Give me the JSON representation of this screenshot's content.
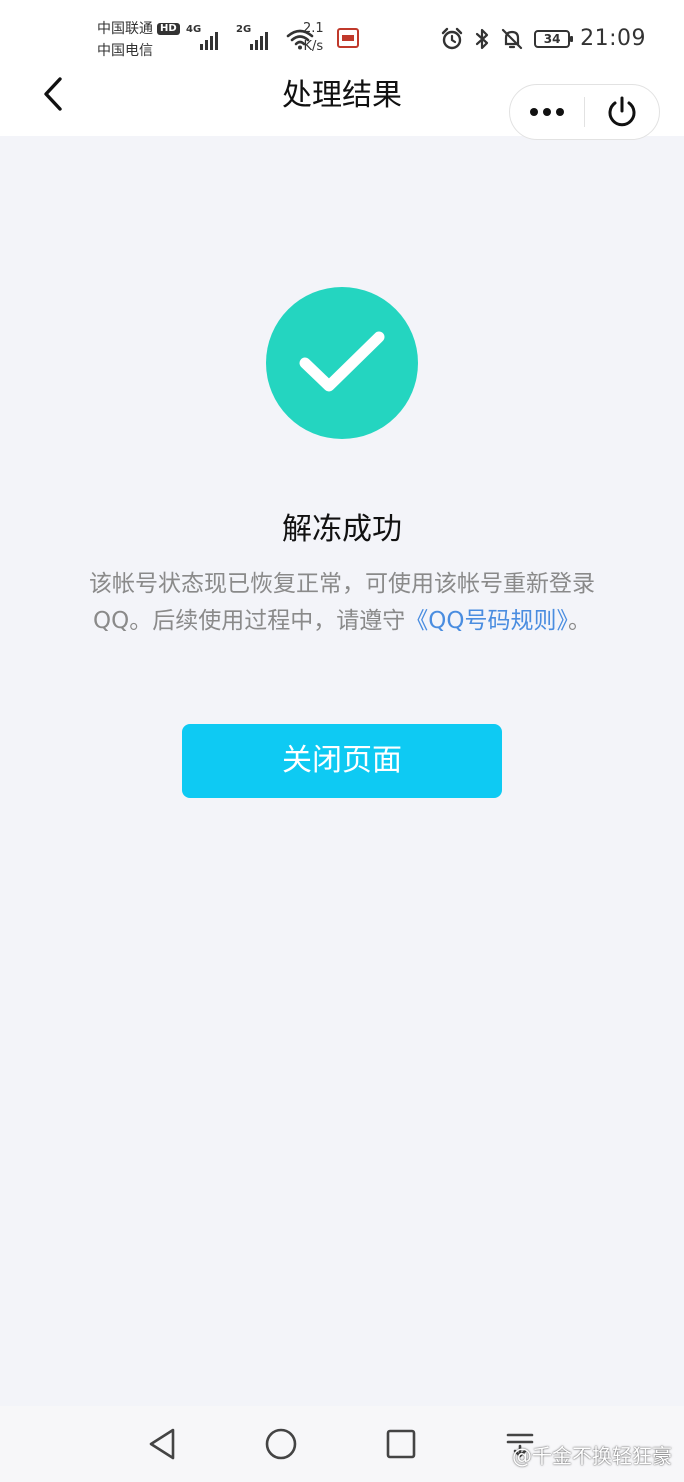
{
  "status_bar": {
    "carrier_1": "中国联通",
    "carrier_1_badge": "HD",
    "carrier_2": "中国电信",
    "signal_1_gen": "4G",
    "signal_2_gen": "2G",
    "net_speed_value": "2.1",
    "net_speed_unit": "K/s",
    "battery_level": "34",
    "time": "21:09",
    "icons": [
      "alarm-icon",
      "bluetooth-icon",
      "mute-icon",
      "battery-icon"
    ]
  },
  "header": {
    "title": "处理结果",
    "back_icon": "chevron-left-icon",
    "more_icon": "more-dots-icon",
    "power_icon": "power-icon"
  },
  "result": {
    "icon": "check-icon",
    "circle_color": "#24d5c0",
    "title": "解冻成功",
    "description_text": "该帐号状态现已恢复正常，可使用该帐号重新登录QQ。后续使用过程中，请遵守",
    "rule_link": "《QQ号码规则》",
    "description_end": "。",
    "link_color": "#4a8de0"
  },
  "actions": {
    "close_label": "关闭页面",
    "button_color": "#0ecaf3"
  },
  "system_nav": {
    "back_icon": "triangle-back-icon",
    "home_icon": "circle-home-icon",
    "recents_icon": "square-recents-icon",
    "menu_icon": "menu-lines-icon"
  },
  "watermark": {
    "text": "@千金不换轻狂豪"
  }
}
